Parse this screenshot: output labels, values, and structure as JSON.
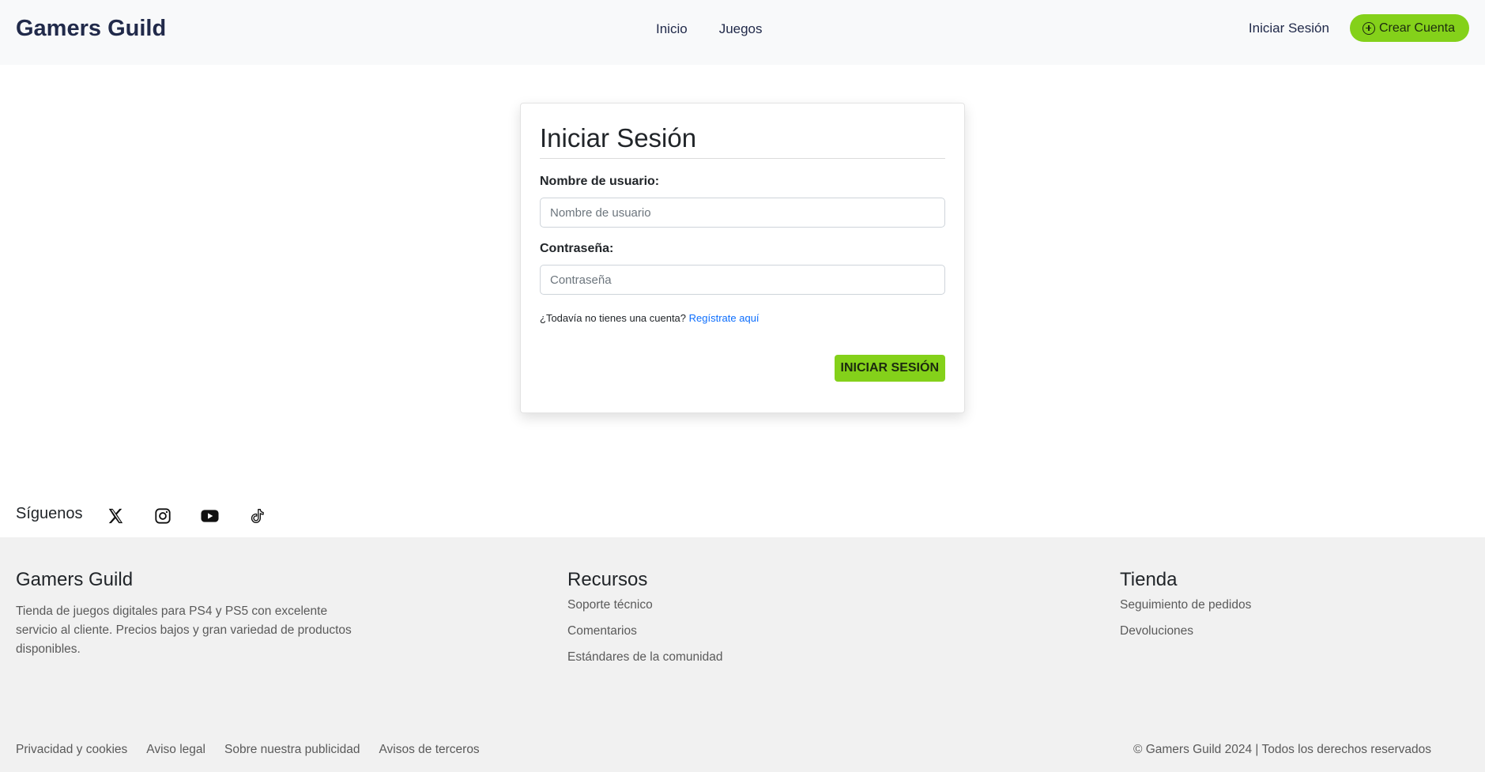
{
  "header": {
    "brand": "Gamers Guild",
    "nav": [
      {
        "label": "Inicio"
      },
      {
        "label": "Juegos"
      }
    ],
    "login_label": "Iniciar Sesión",
    "create_account_label": "Crear Cuenta",
    "create_account_icon": "plus-circle-icon"
  },
  "login": {
    "title": "Iniciar Sesión",
    "username_label": "Nombre de usuario:",
    "username_placeholder": "Nombre de usuario",
    "username_value": "",
    "password_label": "Contraseña:",
    "password_placeholder": "Contraseña",
    "password_value": "",
    "register_prompt": "¿Todavía no tienes una cuenta?",
    "register_link": "Regístrate aquí",
    "submit_label": "INICIAR SESIÓN"
  },
  "follow": {
    "label": "Síguenos",
    "icons": [
      "x-icon",
      "instagram-icon",
      "youtube-icon",
      "tiktok-icon"
    ]
  },
  "footer": {
    "about": {
      "title": "Gamers Guild",
      "text": "Tienda de juegos digitales para PS4 y PS5 con excelente servicio al cliente. Precios bajos y gran variedad de productos disponibles."
    },
    "resources": {
      "title": "Recursos",
      "links": [
        "Soporte técnico",
        "Comentarios",
        "Estándares de la comunidad"
      ]
    },
    "store": {
      "title": "Tienda",
      "links": [
        "Seguimiento de pedidos",
        "Devoluciones"
      ]
    },
    "legal": [
      "Privacidad y cookies",
      "Aviso legal",
      "Sobre nuestra publicidad",
      "Avisos de terceros"
    ],
    "copyright": "© Gamers Guild 2024 | Todos los derechos reservados"
  },
  "colors": {
    "accent": "#84d11a",
    "navbar_bg": "#f8f9fa",
    "footer_bg": "#f1f1f1",
    "link": "#0d6efd"
  }
}
